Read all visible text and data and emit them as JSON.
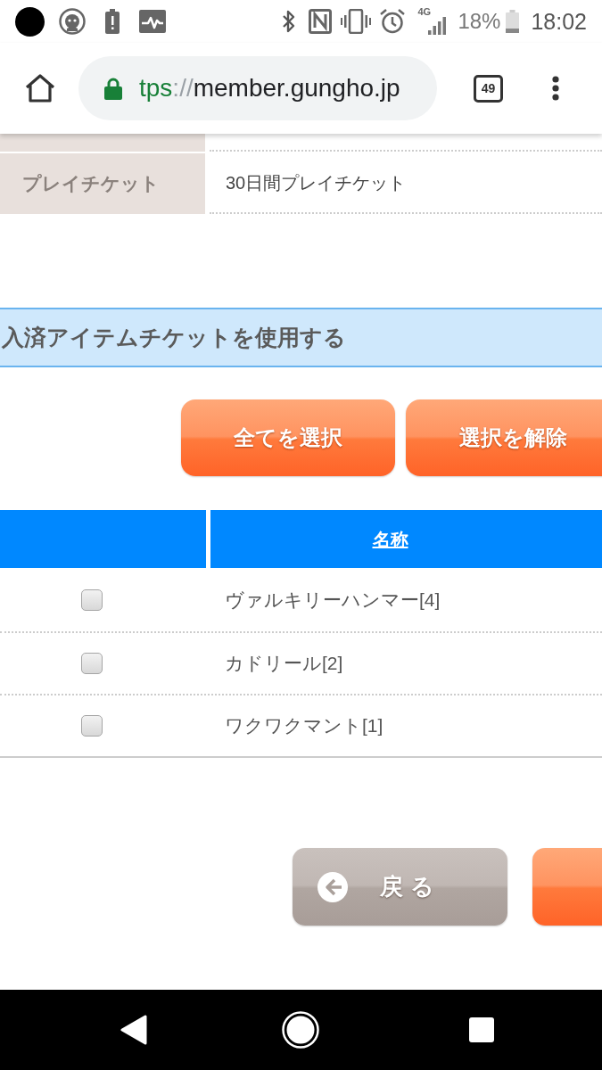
{
  "status_bar": {
    "network": "4G",
    "battery": "18%",
    "time": "18:02"
  },
  "browser": {
    "url": {
      "scheme": "tps",
      "separator": "://",
      "host": "member.gungho.jp"
    },
    "tab_count": "49"
  },
  "info_table": {
    "rows": [
      {
        "label": "プレイチケット",
        "value": "30日間プレイチケット"
      }
    ]
  },
  "section": {
    "title": "入済アイテムチケットを使用する"
  },
  "selection_buttons": [
    "全てを選択",
    "選択を解除"
  ],
  "items_table": {
    "name_column": "名称",
    "rows": [
      {
        "checked": false,
        "name": "ヴァルキリーハンマー[4]"
      },
      {
        "checked": false,
        "name": "カドリール[2]"
      },
      {
        "checked": false,
        "name": "ワクワクマント[1]"
      }
    ]
  },
  "footer_buttons": [
    {
      "kind": "back",
      "label": "戻る"
    },
    {
      "kind": "primary"
    }
  ]
}
